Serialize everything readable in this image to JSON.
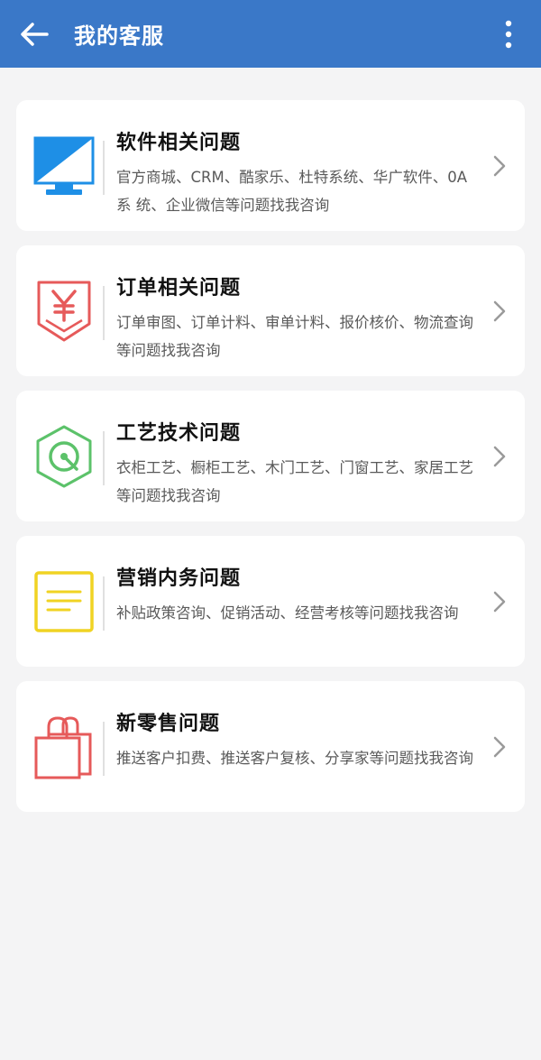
{
  "header": {
    "title": "我的客服",
    "back_icon": "arrow-left-icon",
    "more_icon": "more-vertical-icon",
    "color": "#3a78c8"
  },
  "categories": [
    {
      "title": "软件相关问题",
      "desc": "官方商城、CRM、酷家乐、杜特系统、华广软件、0A系 统、企业微信等问题找我咨询",
      "icon": "monitor-icon",
      "color": "#1e8fe6"
    },
    {
      "title": "订单相关问题",
      "desc": "订单审图、订单计料、审单计料、报价核价、物流查询等问题找我咨询",
      "icon": "yuan-order-icon",
      "color": "#e65a5a"
    },
    {
      "title": "工艺技术问题",
      "desc": "衣柜工艺、橱柜工艺、木门工艺、门窗工艺、家居工艺等问题找我咨询",
      "icon": "hexagon-gear-icon",
      "color": "#5cc26a"
    },
    {
      "title": "营销内务问题",
      "desc": "补贴政策咨询、促销活动、经营考核等问题找我咨询",
      "icon": "notepad-icon",
      "color": "#f0d323"
    },
    {
      "title": "新零售问题",
      "desc": "推送客户扣费、推送客户复核、分享家等问题找我咨询",
      "icon": "shopping-bag-icon",
      "color": "#e65a5a"
    }
  ]
}
